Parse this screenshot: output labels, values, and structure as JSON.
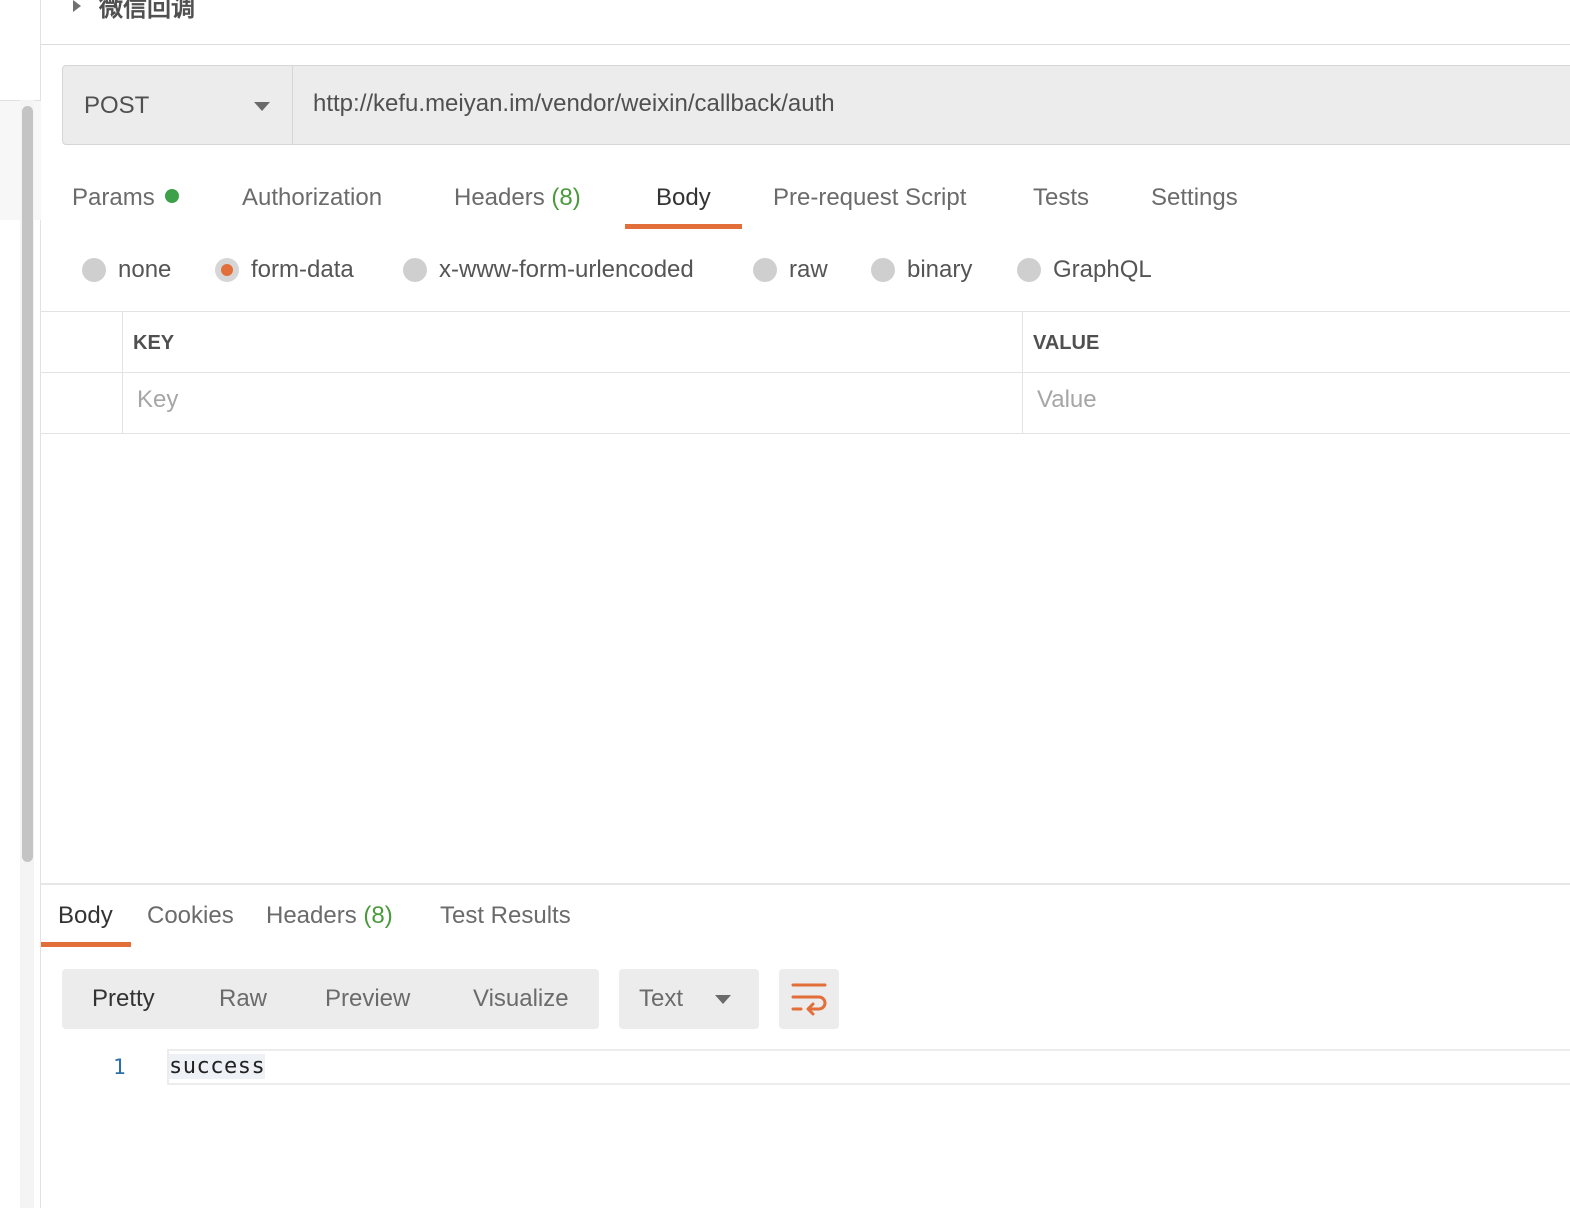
{
  "request": {
    "name": "微信回调",
    "method": "POST",
    "url": "http://kefu.meiyan.im/vendor/weixin/callback/auth"
  },
  "request_tabs": {
    "params": "Params",
    "authorization": "Authorization",
    "headers": "Headers",
    "headers_count": "(8)",
    "body": "Body",
    "pre_request": "Pre-request Script",
    "tests": "Tests",
    "settings": "Settings"
  },
  "body_types": {
    "none": "none",
    "form_data": "form-data",
    "urlencoded": "x-www-form-urlencoded",
    "raw": "raw",
    "binary": "binary",
    "graphql": "GraphQL",
    "selected": "form-data"
  },
  "kv_table": {
    "key_header": "KEY",
    "value_header": "VALUE",
    "key_placeholder": "Key",
    "value_placeholder": "Value"
  },
  "response_tabs": {
    "body": "Body",
    "cookies": "Cookies",
    "headers": "Headers",
    "headers_count": "(8)",
    "test_results": "Test Results"
  },
  "response_view": {
    "pretty": "Pretty",
    "raw": "Raw",
    "preview": "Preview",
    "visualize": "Visualize",
    "format": "Text"
  },
  "response_body": {
    "line_number": "1",
    "content": "success"
  },
  "colors": {
    "accent": "#e26e3a",
    "green": "#3ea049"
  }
}
